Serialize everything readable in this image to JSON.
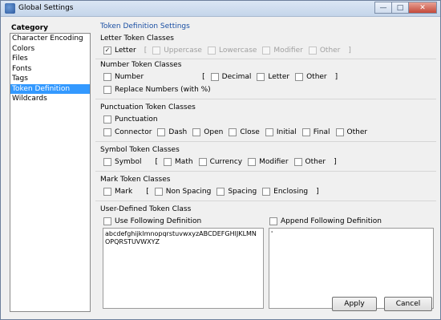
{
  "window": {
    "title": "Global Settings"
  },
  "titlebar_buttons": {
    "minimize": "—",
    "maximize": "□",
    "close": "✕"
  },
  "category": {
    "title": "Category",
    "items": [
      "Character Encoding",
      "Colors",
      "Files",
      "Fonts",
      "Tags",
      "Token Definition",
      "Wildcards"
    ],
    "selected": "Token Definition"
  },
  "section_title": "Token Definition Settings",
  "letter": {
    "title": "Letter Token Classes",
    "letter": "Letter",
    "open": "[",
    "uppercase": "Uppercase",
    "lowercase": "Lowercase",
    "modifier": "Modifier",
    "other": "Other",
    "close": "]"
  },
  "number": {
    "title": "Number Token Classes",
    "number": "Number",
    "open": "[",
    "decimal": "Decimal",
    "letter": "Letter",
    "other": "Other",
    "close": "]",
    "replace": "Replace Numbers (with %)"
  },
  "punct": {
    "title": "Punctuation Token Classes",
    "punctuation": "Punctuation",
    "connector": "Connector",
    "dash": "Dash",
    "open": "Open",
    "close": "Close",
    "initial": "Initial",
    "final": "Final",
    "other": "Other"
  },
  "symbol": {
    "title": "Symbol Token Classes",
    "symbol": "Symbol",
    "open": "[",
    "math": "Math",
    "currency": "Currency",
    "modifier": "Modifier",
    "other": "Other",
    "close": "]"
  },
  "mark": {
    "title": "Mark Token Classes",
    "mark": "Mark",
    "open": "[",
    "nonspacing": "Non Spacing",
    "spacing": "Spacing",
    "enclosing": "Enclosing",
    "close": "]"
  },
  "userdef": {
    "title": "User-Defined Token Class",
    "use_label": "Use Following Definition",
    "use_text": "abcdefghijklmnopqrstuvwxyzABCDEFGHIJKLMNOPQRSTUVWXYZ",
    "append_label": "Append Following Definition",
    "append_text": "'"
  },
  "buttons": {
    "apply": "Apply",
    "cancel": "Cancel"
  },
  "check_mark": "✓"
}
